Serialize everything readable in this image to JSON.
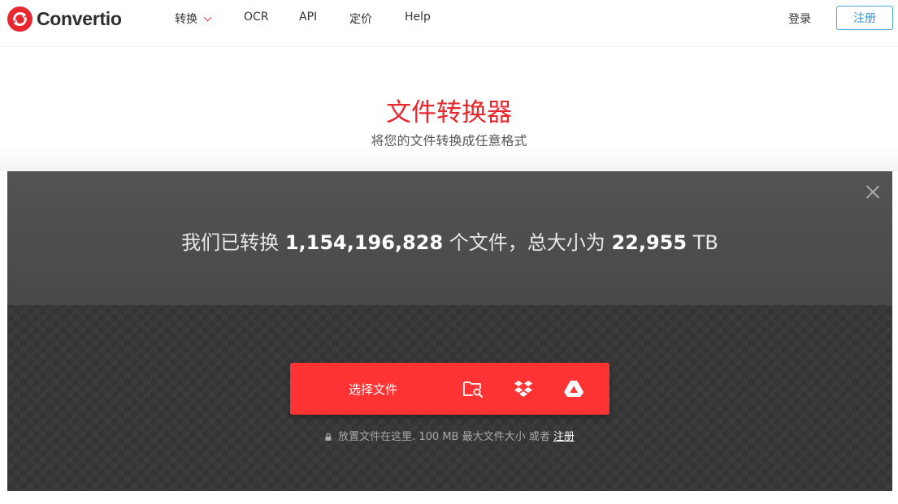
{
  "header": {
    "logo_text": "Convertio",
    "nav": [
      {
        "label": "转换",
        "has_dropdown": true
      },
      {
        "label": "OCR"
      },
      {
        "label": "API"
      },
      {
        "label": "定价"
      },
      {
        "label": "Help"
      }
    ],
    "login_label": "登录",
    "signup_label": "注册"
  },
  "hero": {
    "title": "文件转换器",
    "subtitle": "将您的文件转换成任意格式"
  },
  "stats": {
    "prefix": "我们已转换",
    "files_count": "1,154,196,828",
    "middle": "个文件，总大小为",
    "size_value": "22,955",
    "size_unit": "TB"
  },
  "upload": {
    "choose_label": "选择文件",
    "sources": [
      "folder-search-icon",
      "dropbox-icon",
      "google-drive-icon"
    ],
    "note_text": "放置文件在这里. 100 MB 最大文件大小 或者",
    "note_link": "注册"
  },
  "colors": {
    "brand_red": "#ff3333",
    "title_red": "#e8272f",
    "signup_blue": "#3a97cf",
    "panel_dark": "#353535"
  }
}
